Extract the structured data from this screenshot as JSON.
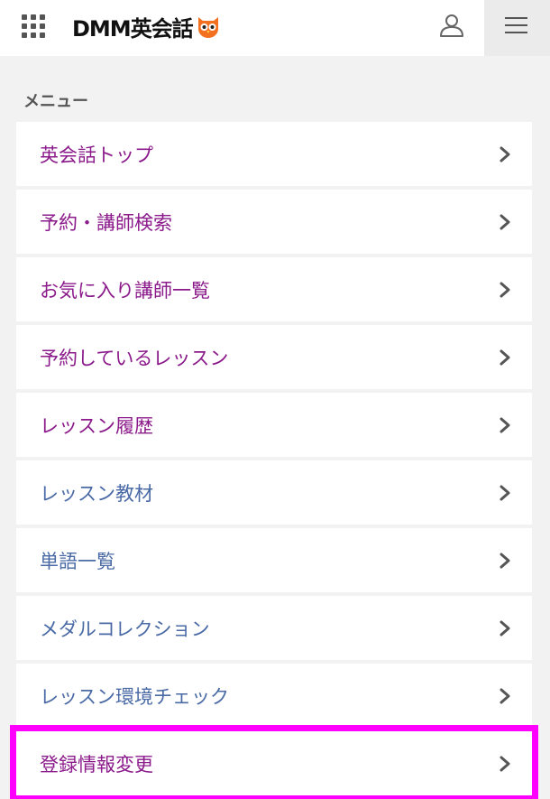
{
  "header": {
    "logo_text": "DMM英会話",
    "grid_icon": "grid-icon",
    "user_icon": "user-icon",
    "menu_icon": "hamburger-menu-icon"
  },
  "section_title": "メニュー",
  "colors": {
    "purple_text": "#8b1a8b",
    "blue_text": "#4a6aa5",
    "highlight": "#ff00ff",
    "owl_orange": "#f37021"
  },
  "menu": [
    {
      "label": "英会話トップ",
      "color": "purple"
    },
    {
      "label": "予約・講師検索",
      "color": "purple"
    },
    {
      "label": "お気に入り講師一覧",
      "color": "purple"
    },
    {
      "label": "予約しているレッスン",
      "color": "purple"
    },
    {
      "label": "レッスン履歴",
      "color": "purple"
    },
    {
      "label": "レッスン教材",
      "color": "blue"
    },
    {
      "label": "単語一覧",
      "color": "blue"
    },
    {
      "label": "メダルコレクション",
      "color": "blue"
    },
    {
      "label": "レッスン環境チェック",
      "color": "blue"
    },
    {
      "label": "登録情報変更",
      "color": "purple",
      "highlighted": true
    }
  ]
}
